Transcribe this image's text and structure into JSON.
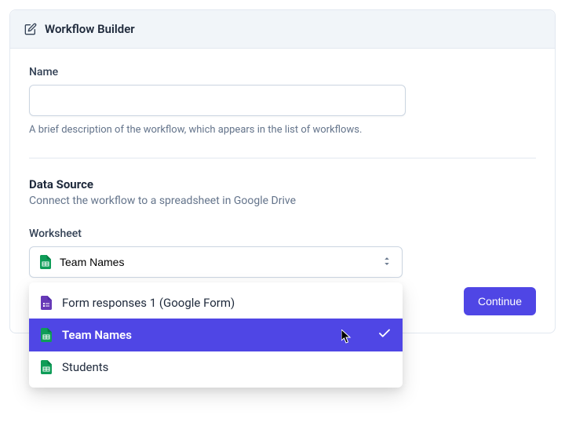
{
  "header": {
    "title": "Workflow Builder"
  },
  "nameField": {
    "label": "Name",
    "value": "",
    "help": "A brief description of the workflow, which appears in the list of workflows."
  },
  "dataSource": {
    "title": "Data Source",
    "desc": "Connect the workflow to a spreadsheet in Google Drive",
    "worksheetLabel": "Worksheet",
    "selected": "Team Names",
    "options": [
      {
        "label": "Form responses 1 (Google Form)",
        "icon": "form-icon",
        "color": "#673ab7"
      },
      {
        "label": "Team Names",
        "icon": "sheet-icon",
        "color": "#0f9d58"
      },
      {
        "label": "Students",
        "icon": "sheet-icon",
        "color": "#0f9d58"
      }
    ]
  },
  "actions": {
    "continue": "Continue"
  }
}
